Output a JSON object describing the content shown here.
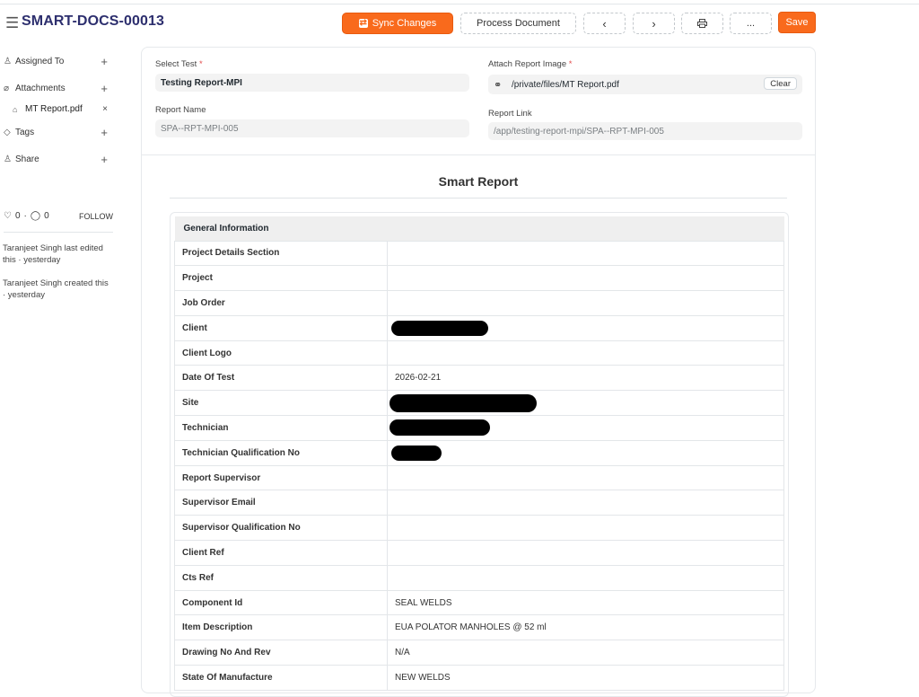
{
  "header": {
    "menu_icon": "hamburger-icon",
    "title": "SMART-DOCS-00013",
    "sync_label": "Sync Changes",
    "process_label": "Process Document",
    "prev_icon": "chevron-left-icon",
    "next_icon": "chevron-right-icon",
    "print_icon": "printer-icon",
    "more_label": "...",
    "save_label": "Save",
    "accent": "#f96a1c"
  },
  "sidebar": {
    "assigned_to": "Assigned To",
    "attachments": "Attachments",
    "attachment_file": "MT Report.pdf",
    "tags": "Tags",
    "share": "Share",
    "likes": "0",
    "comments": "0",
    "follow": "FOLLOW",
    "activity": [
      "Taranjeet Singh last edited this · yesterday",
      "Taranjeet Singh created this · yesterday"
    ]
  },
  "form": {
    "select_test_label": "Select Test",
    "select_test_value": "Testing Report-MPI",
    "report_name_label": "Report Name",
    "report_name_value": "SPA--RPT-MPI-005",
    "attach_label": "Attach Report Image",
    "attach_value": "/private/files/MT Report.pdf",
    "clear_label": "Clear",
    "report_link_label": "Report Link",
    "report_link_value": "/app/testing-report-mpi/SPA--RPT-MPI-005"
  },
  "report": {
    "title": "Smart Report",
    "section_header": "General Information",
    "rows": [
      {
        "key": "Project Details Section",
        "value": ""
      },
      {
        "key": "Project",
        "value": ""
      },
      {
        "key": "Job Order",
        "value": ""
      },
      {
        "key": "Client",
        "value": ""
      },
      {
        "key": "Client Logo",
        "value": ""
      },
      {
        "key": "Date Of Test",
        "value": "2026-02-21"
      },
      {
        "key": "Site",
        "value": ""
      },
      {
        "key": "Technician",
        "value": ""
      },
      {
        "key": "Technician Qualification No",
        "value": ""
      },
      {
        "key": "Report Supervisor",
        "value": ""
      },
      {
        "key": "Supervisor Email",
        "value": ""
      },
      {
        "key": "Supervisor Qualification No",
        "value": ""
      },
      {
        "key": "Client Ref",
        "value": ""
      },
      {
        "key": "Cts Ref",
        "value": ""
      },
      {
        "key": "Component Id",
        "value": "SEAL WELDS"
      },
      {
        "key": "Item Description",
        "value": "EUA POLATOR MANHOLES @ 52 ml"
      },
      {
        "key": "Drawing No And Rev",
        "value": "N/A"
      },
      {
        "key": "State Of Manufacture",
        "value": "NEW WELDS"
      }
    ]
  }
}
